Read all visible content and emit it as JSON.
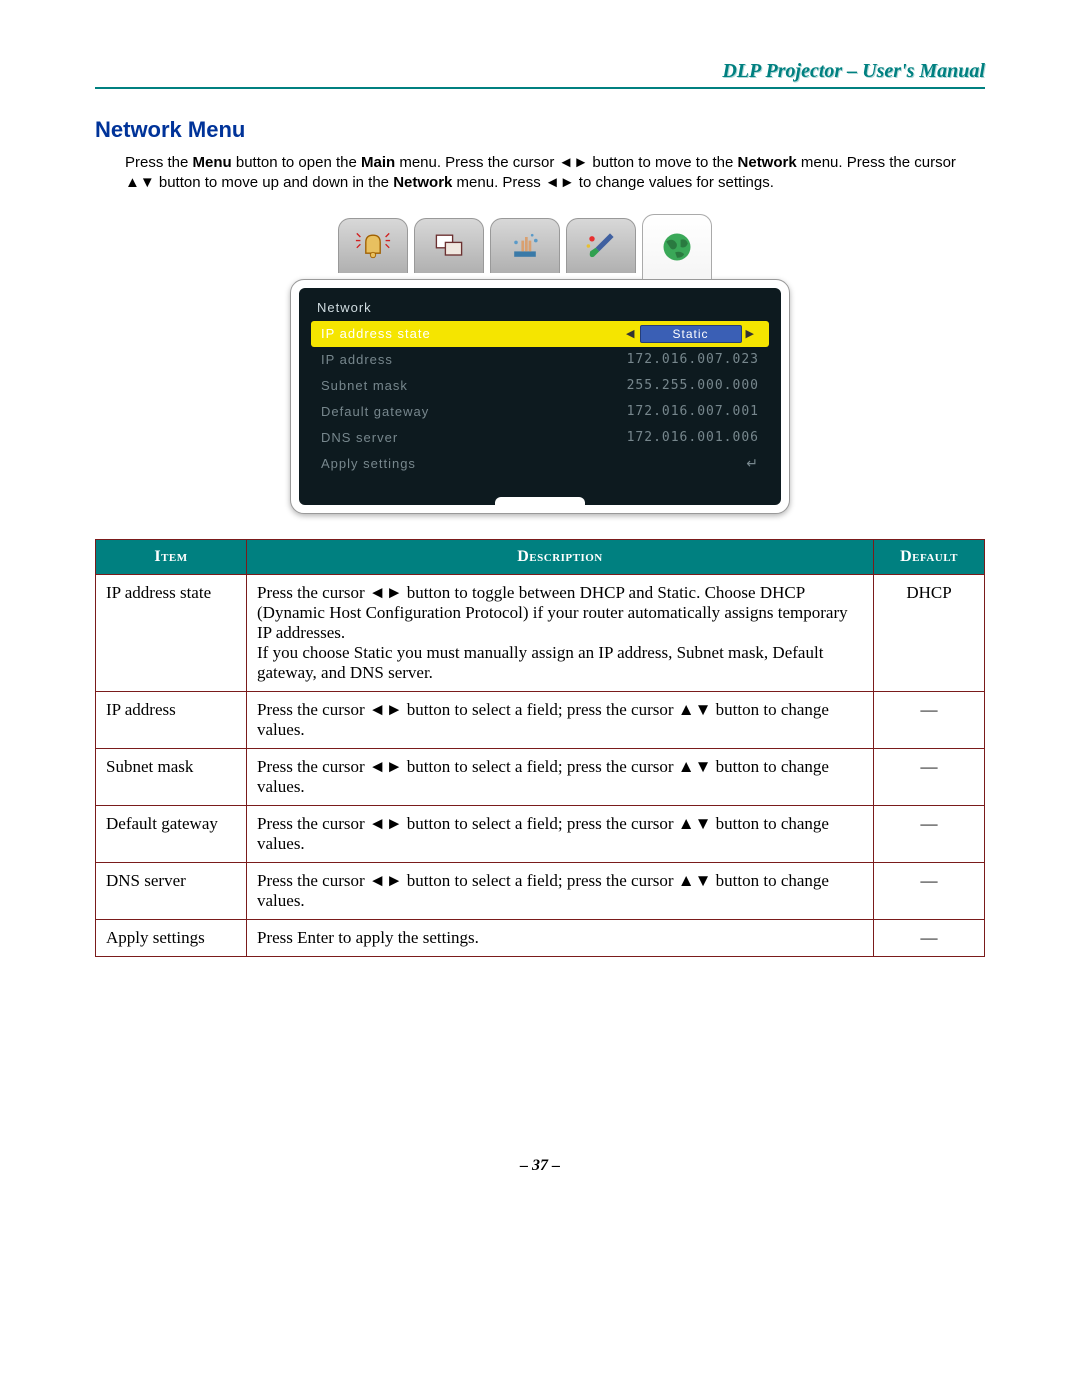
{
  "doc_title": "DLP Projector – User's Manual",
  "section_heading": "Network Menu",
  "intro": {
    "p1a": "Press the ",
    "p1b": "Menu",
    "p1c": " button to open the ",
    "p1d": "Main",
    "p1e": " menu. Press the cursor ◄► button to move to the ",
    "p1f": "Network",
    "p1g": " menu. Press the cursor ▲▼ button to move up and down in the ",
    "p1h": "Network",
    "p1i": " menu. Press ◄► to change values for settings."
  },
  "osd": {
    "label": "Network",
    "rows": [
      {
        "label": "IP address state",
        "value": "Static",
        "highlight": true
      },
      {
        "label": "IP address",
        "value": "172.016.007.023"
      },
      {
        "label": "Subnet mask",
        "value": "255.255.000.000"
      },
      {
        "label": "Default gateway",
        "value": "172.016.007.001"
      },
      {
        "label": "DNS server",
        "value": "172.016.001.006"
      },
      {
        "label": "Apply settings",
        "value": "↵",
        "enter": true
      }
    ]
  },
  "table": {
    "headers": {
      "item": "Item",
      "desc": "Description",
      "def": "Default"
    },
    "rows": [
      {
        "item": "IP address state",
        "desc": "Press the cursor ◄► button to toggle between DHCP and Static. Choose DHCP (Dynamic Host Configuration Protocol) if your router automatically assigns temporary IP addresses.\nIf you choose Static you must manually assign an IP address, Subnet mask, Default gateway, and DNS server.",
        "def": "DHCP"
      },
      {
        "item": "IP address",
        "desc": "Press the cursor ◄► button to select a field; press the cursor ▲▼ button to change values.",
        "def": "—"
      },
      {
        "item": "Subnet mask",
        "desc": "Press the cursor ◄► button to select a field; press the cursor ▲▼ button to change values.",
        "def": "—"
      },
      {
        "item": "Default gateway",
        "desc": "Press the cursor ◄► button to select a field; press the cursor ▲▼ button to change values.",
        "def": "—"
      },
      {
        "item": "DNS server",
        "desc": "Press the cursor ◄► button to select a field; press the cursor ▲▼ button to change values.",
        "def": "—"
      },
      {
        "item": "Apply settings",
        "desc": "Press Enter to apply the settings.",
        "def": "—"
      }
    ]
  },
  "footer": "– 37 –"
}
